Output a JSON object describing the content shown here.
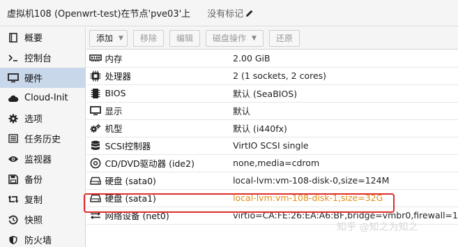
{
  "header": {
    "title": "虚拟机108 (Openwrt-test)在节点'pve03'上",
    "tags_label": "没有标记"
  },
  "sidebar": {
    "items": [
      {
        "label": "概要",
        "icon": "book-icon",
        "active": false
      },
      {
        "label": "控制台",
        "icon": "terminal-icon",
        "active": false
      },
      {
        "label": "硬件",
        "icon": "monitor-icon",
        "active": true
      },
      {
        "label": "Cloud-Init",
        "icon": "cloud-icon",
        "active": false
      },
      {
        "label": "选项",
        "icon": "gear-icon",
        "active": false
      },
      {
        "label": "任务历史",
        "icon": "list-icon",
        "active": false
      },
      {
        "label": "监视器",
        "icon": "eye-icon",
        "active": false
      },
      {
        "label": "备份",
        "icon": "floppy-icon",
        "active": false
      },
      {
        "label": "复制",
        "icon": "retweet-icon",
        "active": false
      },
      {
        "label": "快照",
        "icon": "history-icon",
        "active": false
      },
      {
        "label": "防火墙",
        "icon": "shield-icon",
        "active": false
      }
    ]
  },
  "toolbar": {
    "add_label": "添加",
    "remove_label": "移除",
    "edit_label": "编辑",
    "disk_action_label": "磁盘操作",
    "revert_label": "还原"
  },
  "hardware": {
    "rows": [
      {
        "icon": "memory-icon",
        "name": "内存",
        "value": "2.00 GiB"
      },
      {
        "icon": "cpu-icon",
        "name": "处理器",
        "value": "2 (1 sockets, 2 cores)"
      },
      {
        "icon": "chip-icon",
        "name": "BIOS",
        "value": "默认 (SeaBIOS)"
      },
      {
        "icon": "display-icon",
        "name": "显示",
        "value": "默认"
      },
      {
        "icon": "cogs-icon",
        "name": "机型",
        "value": "默认 (i440fx)"
      },
      {
        "icon": "database-icon",
        "name": "SCSI控制器",
        "value": "VirtIO SCSI single"
      },
      {
        "icon": "cdrom-icon",
        "name": "CD/DVD驱动器 (ide2)",
        "value": "none,media=cdrom"
      },
      {
        "icon": "hdd-icon",
        "name": "硬盘 (sata0)",
        "value": "local-lvm:vm-108-disk-0,size=124M"
      },
      {
        "icon": "hdd-icon",
        "name": "硬盘 (sata1)",
        "value": "local-lvm:vm-108-disk-1,size=32G",
        "pending": true
      },
      {
        "icon": "exchange-icon",
        "name": "网络设备 (net0)",
        "value": "virtio=CA:FE:26:EA:A6:BF,bridge=vmbr0,firewall=1"
      }
    ]
  },
  "watermark": "知乎 @知之为知之",
  "colors": {
    "pending_text": "#e08c18",
    "highlight_border": "#e02b2b",
    "active_nav": "#c8d7ea"
  }
}
